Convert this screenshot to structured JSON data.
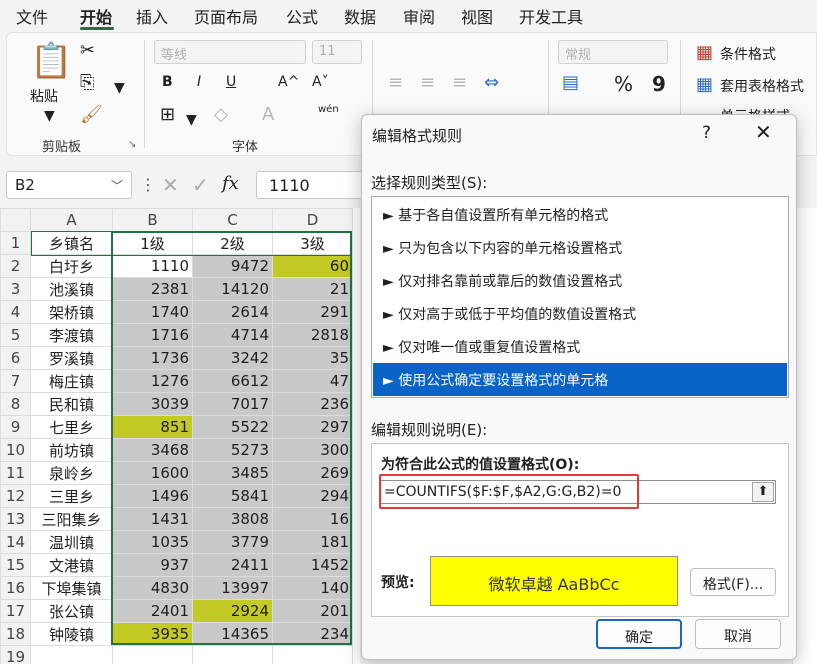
{
  "menu": {
    "items": [
      "文件",
      "开始",
      "插入",
      "页面布局",
      "公式",
      "数据",
      "审阅",
      "视图",
      "开发工具"
    ],
    "active": "开始"
  },
  "ribbon": {
    "clipboard": {
      "paste_label": "粘贴",
      "group_label": "剪贴板"
    },
    "font": {
      "font_name": "等线",
      "font_size": "11",
      "group_label": "字体",
      "bold": "B",
      "italic": "I",
      "underline": "U",
      "grow": "A^",
      "shrink": "A˅",
      "phonetic": "wén"
    },
    "number": {
      "format": "常规",
      "percent": "%",
      "comma": "9"
    },
    "styles": {
      "conditional": "条件格式",
      "table": "套用表格格式",
      "cell": "单元格样式"
    }
  },
  "formula_bar": {
    "name_box": "B2",
    "fx": "fx",
    "value": "1110"
  },
  "sheet": {
    "col_headers": [
      "A",
      "B",
      "C",
      "D"
    ],
    "header_row": [
      "乡镇名",
      "1级",
      "2级",
      "3级"
    ],
    "rows": [
      {
        "n": "2",
        "name": "白圩乡",
        "b": "1110",
        "c": "9472",
        "d": "60",
        "bc": "white",
        "cc": "gray",
        "dc": "yellow"
      },
      {
        "n": "3",
        "name": "池溪镇",
        "b": "2381",
        "c": "14120",
        "d": "21",
        "bc": "gray",
        "cc": "gray",
        "dc": "gray"
      },
      {
        "n": "4",
        "name": "架桥镇",
        "b": "1740",
        "c": "2614",
        "d": "291",
        "bc": "gray",
        "cc": "gray",
        "dc": "gray"
      },
      {
        "n": "5",
        "name": "李渡镇",
        "b": "1716",
        "c": "4714",
        "d": "2818",
        "bc": "gray",
        "cc": "gray",
        "dc": "gray"
      },
      {
        "n": "6",
        "name": "罗溪镇",
        "b": "1736",
        "c": "3242",
        "d": "35",
        "bc": "gray",
        "cc": "gray",
        "dc": "gray"
      },
      {
        "n": "7",
        "name": "梅庄镇",
        "b": "1276",
        "c": "6612",
        "d": "47",
        "bc": "gray",
        "cc": "gray",
        "dc": "gray"
      },
      {
        "n": "8",
        "name": "民和镇",
        "b": "3039",
        "c": "7017",
        "d": "236",
        "bc": "gray",
        "cc": "gray",
        "dc": "gray"
      },
      {
        "n": "9",
        "name": "七里乡",
        "b": "851",
        "c": "5522",
        "d": "297",
        "bc": "yellow",
        "cc": "gray",
        "dc": "gray"
      },
      {
        "n": "10",
        "name": "前坊镇",
        "b": "3468",
        "c": "5273",
        "d": "300",
        "bc": "gray",
        "cc": "gray",
        "dc": "gray"
      },
      {
        "n": "11",
        "name": "泉岭乡",
        "b": "1600",
        "c": "3485",
        "d": "269",
        "bc": "gray",
        "cc": "gray",
        "dc": "gray"
      },
      {
        "n": "12",
        "name": "三里乡",
        "b": "1496",
        "c": "5841",
        "d": "294",
        "bc": "gray",
        "cc": "gray",
        "dc": "gray"
      },
      {
        "n": "13",
        "name": "三阳集乡",
        "b": "1431",
        "c": "3808",
        "d": "16",
        "bc": "gray",
        "cc": "gray",
        "dc": "gray"
      },
      {
        "n": "14",
        "name": "温圳镇",
        "b": "1035",
        "c": "3779",
        "d": "181",
        "bc": "gray",
        "cc": "gray",
        "dc": "gray"
      },
      {
        "n": "15",
        "name": "文港镇",
        "b": "937",
        "c": "2411",
        "d": "1452",
        "bc": "gray",
        "cc": "gray",
        "dc": "gray"
      },
      {
        "n": "16",
        "name": "下埠集镇",
        "b": "4830",
        "c": "13997",
        "d": "140",
        "bc": "gray",
        "cc": "gray",
        "dc": "gray"
      },
      {
        "n": "17",
        "name": "张公镇",
        "b": "2401",
        "c": "2924",
        "d": "201",
        "bc": "gray",
        "cc": "yellow",
        "dc": "gray"
      },
      {
        "n": "18",
        "name": "钟陵镇",
        "b": "3935",
        "c": "14365",
        "d": "234",
        "bc": "yellow",
        "cc": "gray",
        "dc": "gray"
      }
    ],
    "extra_row": "19"
  },
  "dialog": {
    "title": "编辑格式规则",
    "help": "?",
    "close": "✕",
    "select_type_label": "选择规则类型(S):",
    "rule_types": [
      "► 基于各自值设置所有单元格的格式",
      "► 只为包含以下内容的单元格设置格式",
      "► 仅对排名靠前或靠后的数值设置格式",
      "► 仅对高于或低于平均值的数值设置格式",
      "► 仅对唯一值或重复值设置格式",
      "► 使用公式确定要设置格式的单元格"
    ],
    "selected_rule": 5,
    "edit_desc_label": "编辑规则说明(E):",
    "formula_heading": "为符合此公式的值设置格式(O):",
    "formula": "=COUNTIFS($F:$F,$A2,G:G,B2)=0",
    "preview_label": "预览:",
    "preview_text": "微软卓越  AaBbCc",
    "format_button": "格式(F)...",
    "ok_button": "确定",
    "cancel_button": "取消"
  },
  "colors": {
    "accent_green": "#1f7244",
    "cell_gray": "#c9c9c9",
    "cell_yellow": "#c3c925",
    "selection_blue": "#0a64c8",
    "preview_yellow": "#ffff00",
    "highlight_red": "#e03b3b"
  }
}
